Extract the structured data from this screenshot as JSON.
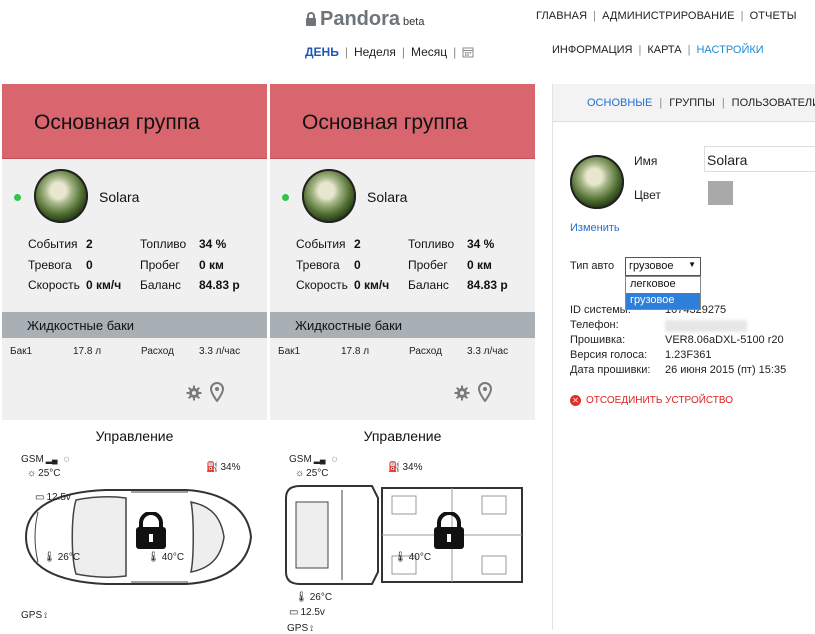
{
  "header": {
    "logo_text": "Pandora",
    "logo_badge": "beta",
    "period_tabs": [
      "ДЕНЬ",
      "Неделя",
      "Месяц"
    ],
    "main_nav": [
      "ГЛАВНАЯ",
      "АДМИНИСТРИРОВАНИЕ",
      "ОТЧЕТЫ"
    ],
    "sub_nav": [
      "ИНФОРМАЦИЯ",
      "КАРТА",
      "НАСТРОЙКИ"
    ]
  },
  "cards": [
    {
      "title": "Основная группа",
      "device_name": "Solara",
      "stats": {
        "events_label": "События",
        "events": "2",
        "alarm_label": "Тревога",
        "alarm": "0",
        "speed_label": "Скорость",
        "speed": "0 км/ч",
        "fuel_label": "Топливо",
        "fuel": "34 %",
        "mileage_label": "Пробег",
        "mileage": "0 км",
        "balance_label": "Баланс",
        "balance": "84.83 р"
      },
      "tanks_section": "Жидкостные баки",
      "tank": {
        "name": "Бак1",
        "volume": "17.8 л",
        "rate_label": "Расход",
        "rate": "3.3 л/час"
      },
      "control_title": "Управление",
      "gsm": "GSM",
      "outside_temp": "25°C",
      "fuel_pct": "34%",
      "voltage": "12.5v",
      "engine_temp": "26°C",
      "cabin_temp": "40°C",
      "gps": "GPS"
    },
    {
      "title": "Основная группа",
      "device_name": "Solara",
      "stats": {
        "events_label": "События",
        "events": "2",
        "alarm_label": "Тревога",
        "alarm": "0",
        "speed_label": "Скорость",
        "speed": "0 км/ч",
        "fuel_label": "Топливо",
        "fuel": "34 %",
        "mileage_label": "Пробег",
        "mileage": "0 км",
        "balance_label": "Баланс",
        "balance": "84.83 р"
      },
      "tanks_section": "Жидкостные баки",
      "tank": {
        "name": "Бак1",
        "volume": "17.8 л",
        "rate_label": "Расход",
        "rate": "3.3 л/час"
      },
      "control_title": "Управление",
      "gsm": "GSM",
      "outside_temp": "25°C",
      "fuel_pct": "34%",
      "voltage": "12.5v",
      "engine_temp": "26°C",
      "cabin_temp": "40°C",
      "gps": "GPS"
    }
  ],
  "settings": {
    "tabs": [
      "ОСНОВНЫЕ",
      "ГРУППЫ",
      "ПОЛЬЗОВАТЕЛИ"
    ],
    "name_label": "Имя",
    "name_value": "Solara",
    "color_label": "Цвет",
    "change_link": "Изменить",
    "car_type_label": "Тип авто",
    "car_type_value": "грузовое",
    "car_type_options": [
      "легковое",
      "грузовое"
    ],
    "system_id_label": "ID системы:",
    "system_id_value": "1074329275",
    "phone_label": "Телефон:",
    "firmware_label": "Прошивка:",
    "firmware_value": "VER8.06aDXL-5100 r20",
    "voice_label": "Версия голоса:",
    "voice_value": "1.23F361",
    "firmware_date_label": "Дата прошивки:",
    "firmware_date_value": "26 июня 2015 (пт) 15:35",
    "disconnect_label": "ОТСОЕДИНИТЬ УСТРОЙСТВО"
  }
}
